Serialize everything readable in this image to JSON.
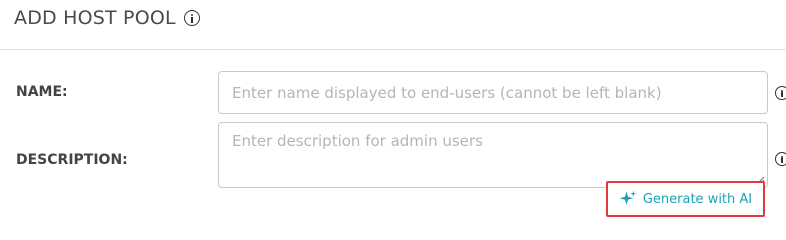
{
  "header": {
    "title": "ADD HOST POOL"
  },
  "form": {
    "name": {
      "label": "NAME:",
      "value": "",
      "placeholder": "Enter name displayed to end-users (cannot be left blank)"
    },
    "description": {
      "label": "DESCRIPTION:",
      "value": "",
      "placeholder": "Enter description for admin users"
    },
    "generate_ai": {
      "label": "Generate with AI"
    }
  },
  "icons": {
    "title_info": "info-icon",
    "name_info": "info-icon",
    "description_info": "info-icon",
    "ai": "sparkle-icon"
  },
  "colors": {
    "accent": "#1aa3b8",
    "highlight_border": "#e0393e",
    "placeholder": "#b5b5b5"
  }
}
